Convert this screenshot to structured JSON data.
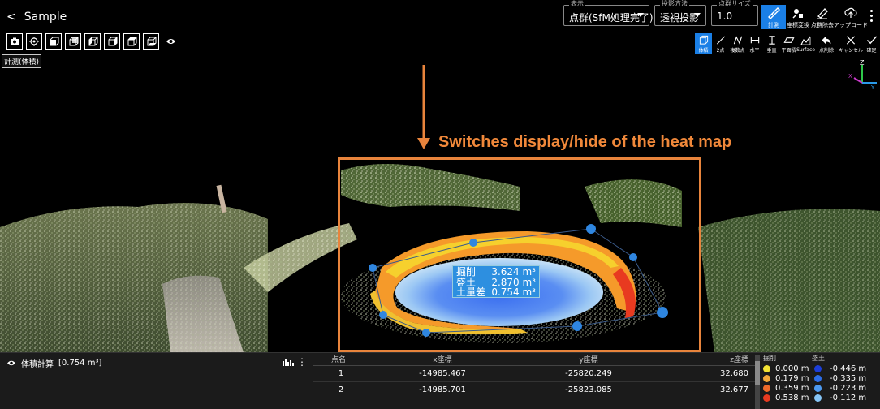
{
  "app": {
    "title": "Sample",
    "back_glyph": "<"
  },
  "header": {
    "display": {
      "caption": "表示",
      "value": "点群(SfM処理完了)"
    },
    "projection": {
      "caption": "投影方法",
      "value": "透視投影"
    },
    "point_size": {
      "caption": "点群サイズ",
      "value": "1.0"
    },
    "tools": [
      {
        "label": "計測",
        "icon": "ruler-icon",
        "active": true
      },
      {
        "label": "座標変換",
        "icon": "transform-icon",
        "active": false
      },
      {
        "label": "点群除去",
        "icon": "eraser-icon",
        "active": false
      },
      {
        "label": "アップロード",
        "icon": "upload-icon",
        "active": false
      }
    ]
  },
  "left_tools": [
    {
      "name": "camera",
      "icon": "camera-icon"
    },
    {
      "name": "target",
      "icon": "target-icon"
    },
    {
      "name": "view-front",
      "icon": "cube-front-icon"
    },
    {
      "name": "view-back",
      "icon": "cube-back-icon"
    },
    {
      "name": "view-left",
      "icon": "cube-left-icon"
    },
    {
      "name": "view-right",
      "icon": "cube-right-icon"
    },
    {
      "name": "view-top",
      "icon": "cube-top-icon"
    },
    {
      "name": "view-bottom",
      "icon": "cube-bottom-icon"
    },
    {
      "name": "visibility",
      "icon": "eye-icon"
    }
  ],
  "mode_label": "計測(体積)",
  "measure_tools": [
    {
      "label": "体積",
      "icon": "cube-icon",
      "active": true
    },
    {
      "label": "2点",
      "icon": "line-icon",
      "active": false
    },
    {
      "label": "複数点",
      "icon": "polyline-icon",
      "active": false
    },
    {
      "label": "水平",
      "icon": "horizontal-icon",
      "active": false
    },
    {
      "label": "垂直",
      "icon": "vertical-icon",
      "active": false
    },
    {
      "label": "平面積",
      "icon": "area-icon",
      "active": false
    },
    {
      "label": "Surface",
      "icon": "surface-icon",
      "active": false
    },
    {
      "label": "点削除",
      "icon": "undo-icon",
      "active": false
    },
    {
      "label": "キャンセル",
      "icon": "close-icon",
      "active": false
    },
    {
      "label": "確定",
      "icon": "check-icon",
      "active": false
    }
  ],
  "axis": {
    "z": "Z",
    "y": "Y",
    "x": "X"
  },
  "annotation": {
    "text": "Switches display/hide of the heat map"
  },
  "volume_label": {
    "rows": [
      {
        "name": "掘削",
        "value": "3.624 m³"
      },
      {
        "name": "盛土",
        "value": "2.870 m³"
      },
      {
        "name": "土量差",
        "value": "0.754 m³"
      }
    ]
  },
  "volume_panel": {
    "title": "体積計算",
    "value": "[0.754 m³]"
  },
  "table": {
    "headers": [
      "点名",
      "x座標",
      "y座標",
      "z座標"
    ],
    "rows": [
      [
        "1",
        "-14985.467",
        "-25820.249",
        "32.680"
      ],
      [
        "2",
        "-14985.701",
        "-25823.085",
        "32.677"
      ]
    ]
  },
  "legend": {
    "headers": [
      "掘削",
      "盛土"
    ],
    "rows": [
      {
        "cut": "0.000 m",
        "cut_color": "#f2e234",
        "fill": "-0.446 m",
        "fill_color": "#1c3ed8"
      },
      {
        "cut": "0.179 m",
        "cut_color": "#f2a83a",
        "fill": "-0.335 m",
        "fill_color": "#2d6ee8"
      },
      {
        "cut": "0.359 m",
        "cut_color": "#ee6a2a",
        "fill": "-0.223 m",
        "fill_color": "#4d9af0"
      },
      {
        "cut": "0.538 m",
        "cut_color": "#e83a20",
        "fill": "-0.112 m",
        "fill_color": "#86c5f6"
      }
    ]
  }
}
